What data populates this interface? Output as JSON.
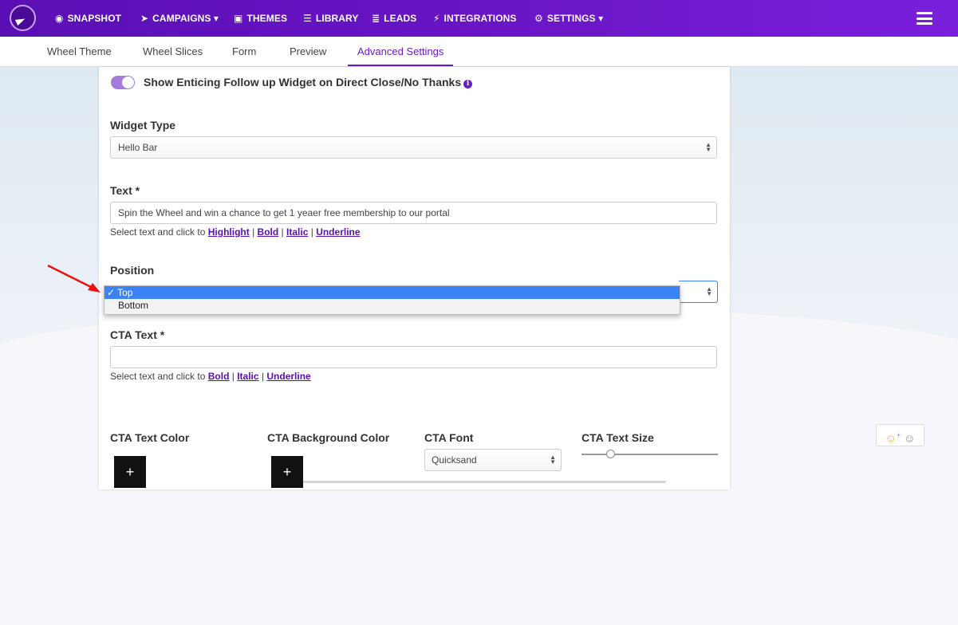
{
  "nav": {
    "items": [
      {
        "icon": "dashboard-icon",
        "glyph": "◉",
        "label": "SNAPSHOT"
      },
      {
        "icon": "paper-plane-icon",
        "glyph": "➤",
        "label": "CAMPAIGNS ▾"
      },
      {
        "icon": "image-icon",
        "glyph": "▣",
        "label": "THEMES"
      },
      {
        "icon": "library-icon",
        "glyph": "☰",
        "label": "LIBRARY"
      },
      {
        "icon": "list-icon",
        "glyph": "≣",
        "label": "LEADS"
      },
      {
        "icon": "plug-icon",
        "glyph": "⚡",
        "label": "INTEGRATIONS"
      },
      {
        "icon": "cogs-icon",
        "glyph": "⚙",
        "label": "SETTINGS ▾"
      }
    ]
  },
  "tabs": [
    "Wheel Theme",
    "Wheel Slices",
    "Form",
    "Preview",
    "Advanced Settings"
  ],
  "active_tab": "Advanced Settings",
  "follow_up": {
    "label": "Show Enticing Follow up Widget on Direct Close/No Thanks",
    "enabled": true,
    "info_glyph": "i"
  },
  "widget_type": {
    "label": "Widget Type",
    "value": "Hello Bar"
  },
  "text_field": {
    "label": "Text *",
    "value": "Spin the Wheel and win a chance to get 1 yeaer free membership to our portal",
    "helper_prefix": "Select text and click to",
    "helper_links": [
      "Highlight",
      "Bold",
      "Italic",
      "Underline"
    ],
    "separator": "|"
  },
  "position": {
    "label": "Position",
    "options": [
      "✓ Top",
      "Bottom"
    ],
    "selected": "Top"
  },
  "cta_text": {
    "label": "CTA Text *",
    "value": "",
    "helper_prefix": "Select text and click to",
    "helper_links": [
      "Bold",
      "Italic",
      "Underline"
    ],
    "separator": "|"
  },
  "cta_columns": {
    "text_color": "CTA Text Color",
    "bg_color": "CTA Background Color",
    "font": "CTA Font",
    "size": "CTA Text Size",
    "font_value": "Quicksand",
    "plus": "+"
  },
  "emoji_button": {
    "glyph": "☺",
    "plus": "+"
  },
  "colors": {
    "nav_start": "#5a0fb4",
    "nav_end": "#7a1fdb",
    "accent": "#6a1bc7",
    "select_highlight": "#3b82f6"
  }
}
